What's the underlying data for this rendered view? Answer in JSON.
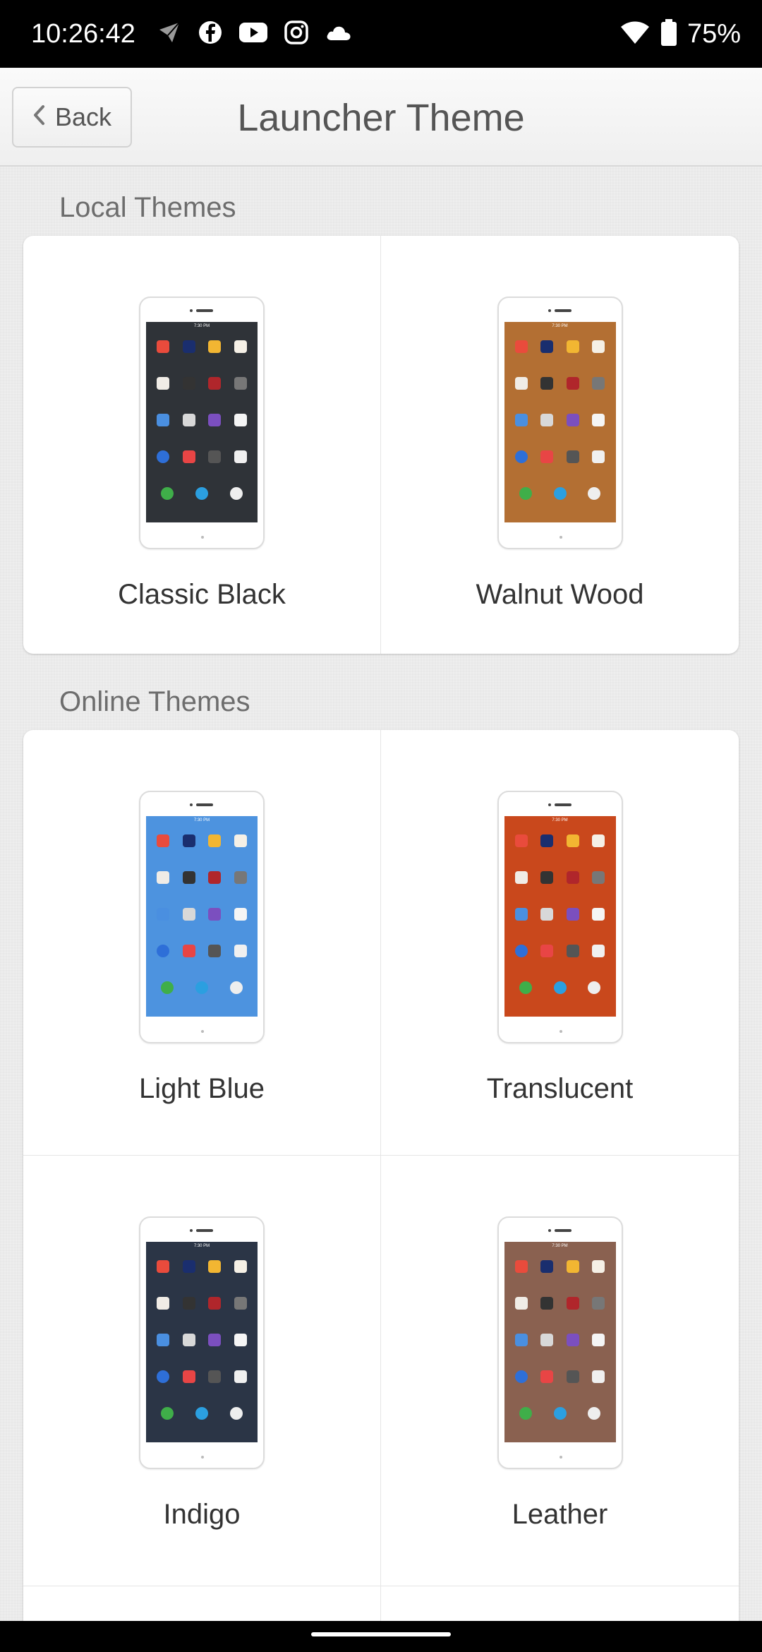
{
  "status_bar": {
    "time": "10:26:42",
    "battery": "75%",
    "left_icons": [
      "messenger-icon",
      "facebook-icon",
      "youtube-icon",
      "instagram-icon",
      "cloud-icon"
    ],
    "right_icons": [
      "wifi-icon",
      "battery-icon"
    ]
  },
  "header": {
    "back_label": "Back",
    "title": "Launcher Theme"
  },
  "local": {
    "section_title": "Local Themes",
    "themes": [
      {
        "name": "Classic Black",
        "bg": "#2f3338"
      },
      {
        "name": "Walnut Wood",
        "bg": "#b36f33"
      }
    ]
  },
  "online": {
    "section_title": "Online Themes",
    "themes": [
      {
        "name": "Light Blue",
        "bg": "#4d93df"
      },
      {
        "name": "Translucent",
        "bg": "#c9481c"
      },
      {
        "name": "Indigo",
        "bg": "#2b3546"
      },
      {
        "name": "Leather",
        "bg": "#8a6150"
      }
    ]
  }
}
